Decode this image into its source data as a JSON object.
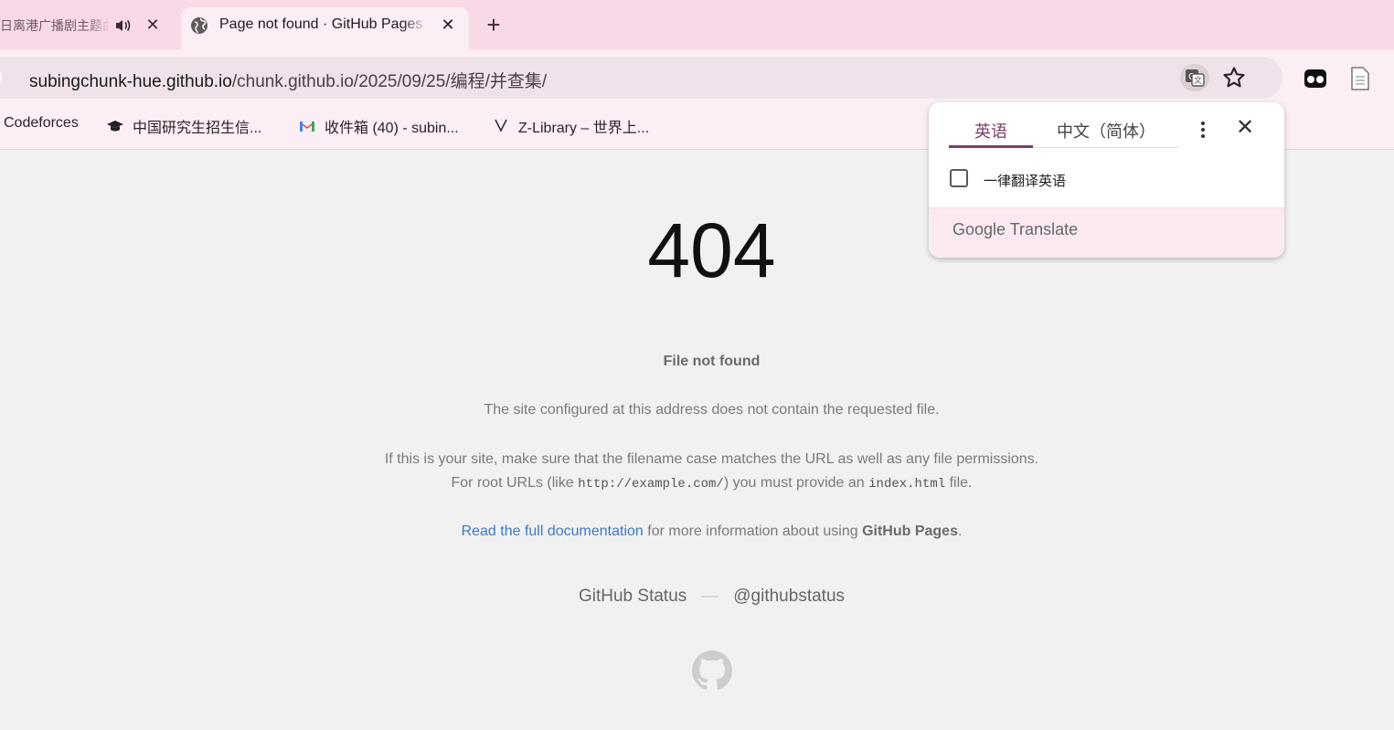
{
  "tabs": [
    {
      "title": "日离港广播剧主题曲",
      "active": false
    },
    {
      "title": "Page not found · GitHub Pages",
      "active": true
    }
  ],
  "address_bar": {
    "host": "subingchunk-hue.github.io",
    "path": "/chunk.github.io/2025/09/25/编程/并查集/"
  },
  "bookmarks": [
    {
      "label": "Codeforces",
      "icon": "codeforces-icon"
    },
    {
      "label": "中国研究生招生信...",
      "icon": "graduation-cap-icon"
    },
    {
      "label": "收件箱 (40) - subin...",
      "icon": "gmail-icon"
    },
    {
      "label": "Z-Library – 世界上...",
      "icon": "zlibrary-icon"
    }
  ],
  "page": {
    "code": "404",
    "heading": "File not found",
    "line1": "The site configured at this address does not contain the requested file.",
    "line2": "If this is your site, make sure that the filename case matches the URL as well as any file permissions.",
    "line3_a": "For root URLs (like ",
    "line3_code1": "http://example.com/",
    "line3_b": ") you must provide an ",
    "line3_code2": "index.html",
    "line3_c": " file.",
    "doc_link": "Read the full documentation",
    "doc_rest": " for more information about using ",
    "doc_bold": "GitHub Pages",
    "doc_end": ".",
    "status_link": "GitHub Status",
    "status_sep": "—",
    "twitter_link": "@githubstatus"
  },
  "translate_popup": {
    "source_lang": "英语",
    "target_lang": "中文（简体）",
    "always_translate": "一律翻译英语",
    "always_translate_checked": false,
    "brand_google": "Google",
    "brand_translate": "Translate"
  },
  "colors": {
    "tabstrip": "#f9d8e8",
    "toolbar": "#fbeef4",
    "link": "#4078c0",
    "accent": "#7a3f6b"
  }
}
